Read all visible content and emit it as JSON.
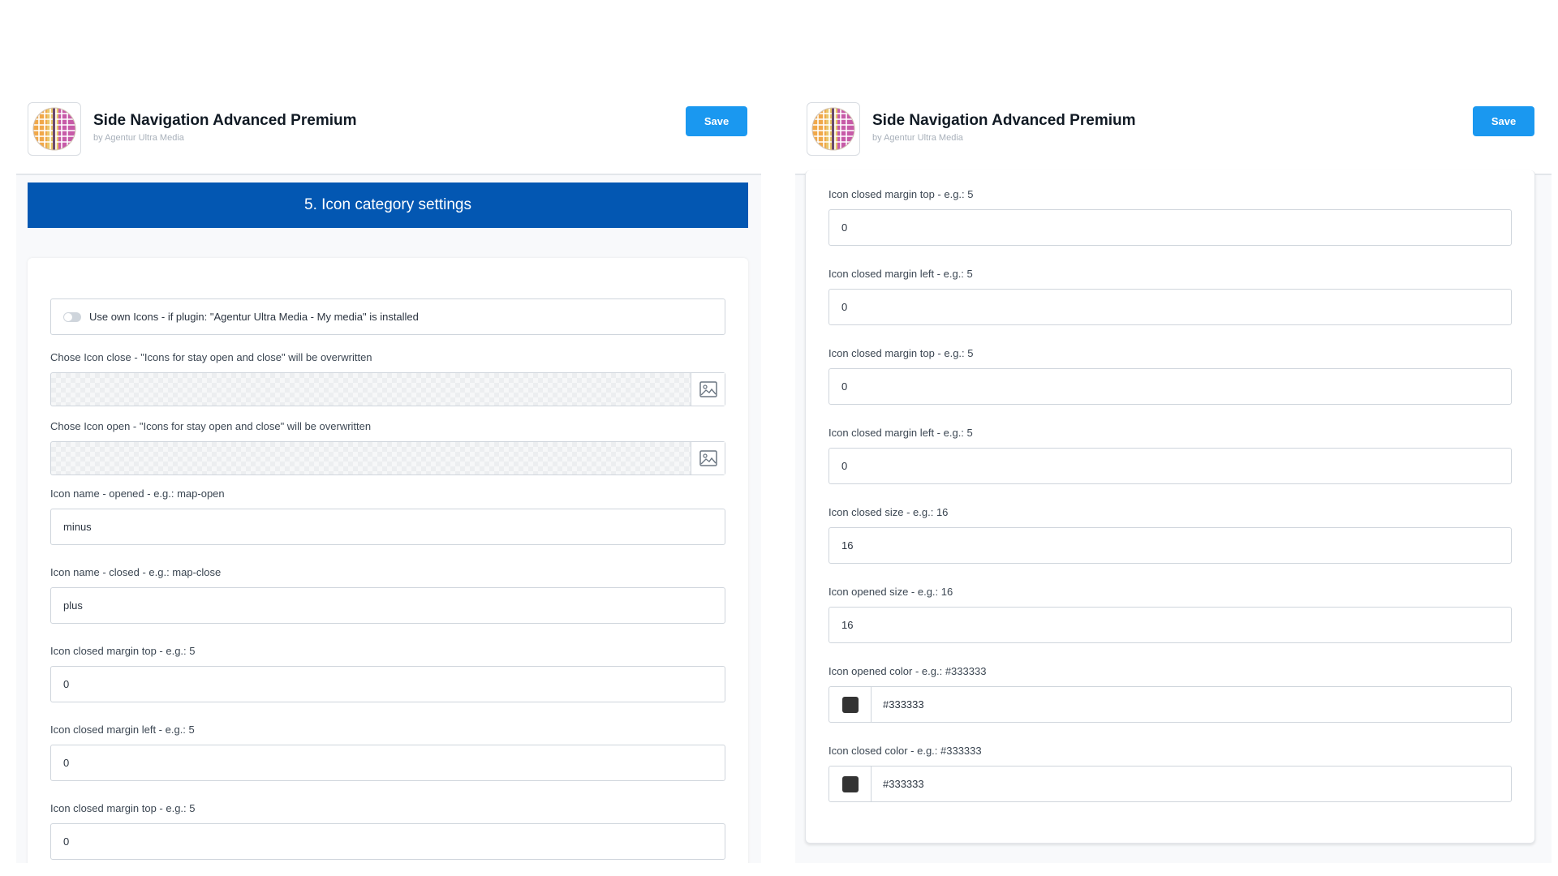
{
  "app": {
    "title": "Side Navigation Advanced Premium",
    "vendor": "by Agentur Ultra Media",
    "save_label": "Save"
  },
  "left": {
    "section_title": "5. Icon category settings",
    "toggle_label": "Use own Icons - if plugin: \"Agentur Ultra Media - My media\" is installed",
    "icon_close_label": "Chose Icon close - \"Icons for stay open and close\" will be overwritten",
    "icon_open_label": "Chose Icon open - \"Icons for stay open and close\" will be overwritten",
    "fields": [
      {
        "label": "Icon name - opened - e.g.: map-open",
        "value": "minus"
      },
      {
        "label": "Icon name - closed - e.g.: map-close",
        "value": "plus"
      },
      {
        "label": "Icon closed margin top - e.g.: 5",
        "value": "0"
      },
      {
        "label": "Icon closed margin left - e.g.: 5",
        "value": "0"
      },
      {
        "label": "Icon closed margin top - e.g.: 5",
        "value": "0"
      }
    ]
  },
  "right": {
    "fields": [
      {
        "label": "Icon closed margin top - e.g.: 5",
        "value": "0"
      },
      {
        "label": "Icon closed margin left - e.g.: 5",
        "value": "0"
      },
      {
        "label": "Icon closed margin top - e.g.: 5",
        "value": "0"
      },
      {
        "label": "Icon closed margin left - e.g.: 5",
        "value": "0"
      },
      {
        "label": "Icon closed size - e.g.: 16",
        "value": "16"
      },
      {
        "label": "Icon opened size - e.g.: 16",
        "value": "16"
      }
    ],
    "colors": [
      {
        "label": "Icon opened color - e.g.: #333333",
        "value": "#333333",
        "swatch": "#333333"
      },
      {
        "label": "Icon closed color - e.g.: #333333",
        "value": "#333333",
        "swatch": "#333333"
      }
    ]
  },
  "theme": {
    "accent": "#1a98f0",
    "banner": "#0357b2"
  },
  "icons": {
    "logo": "mosaic-globe-logo",
    "image_picker": "image-icon",
    "toggle": "toggle-switch"
  }
}
